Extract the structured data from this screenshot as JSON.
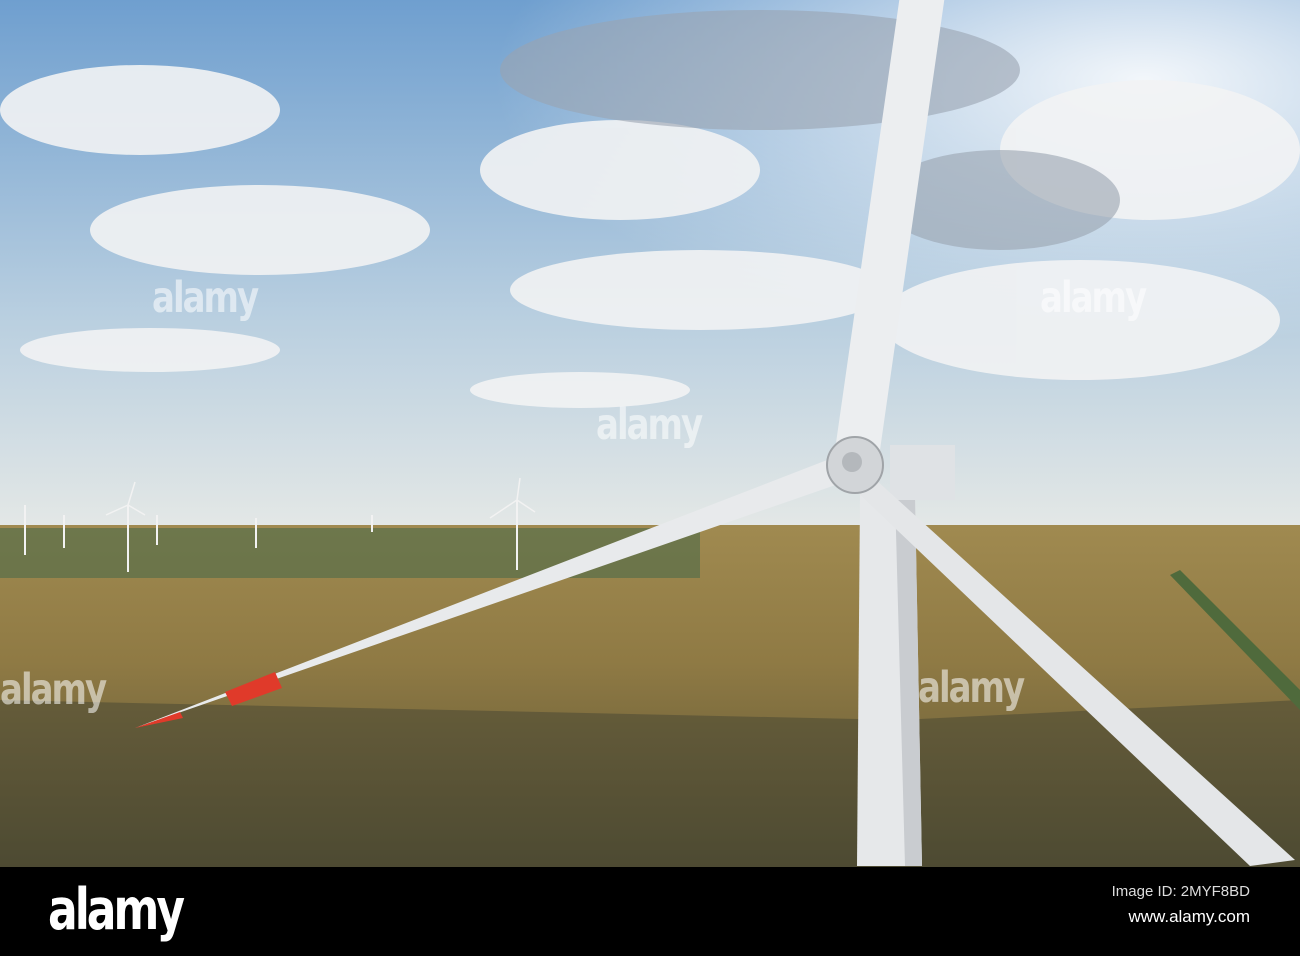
{
  "watermark": {
    "text": "alamy"
  },
  "footer": {
    "logo": "alamy",
    "image_id": "Image ID: 2MYF8BD",
    "website": "www.alamy.com"
  },
  "colors": {
    "sky_top": "#6f9fcf",
    "field": "#8f7a44",
    "blade": "#e8eaec",
    "tip_red": "#e03a2a"
  }
}
